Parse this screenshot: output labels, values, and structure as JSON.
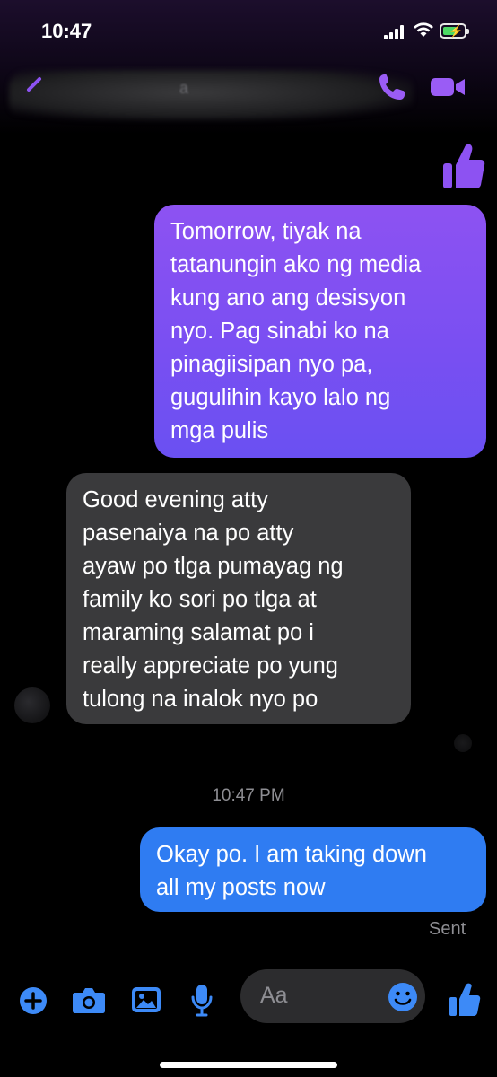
{
  "status_bar": {
    "time": "10:47"
  },
  "header": {
    "contact_name_blurred": "a"
  },
  "messages": [
    {
      "sender": "me",
      "lines": [
        "Tomorrow, tiyak na",
        "tatanungin ako ng media",
        "kung ano ang desisyon",
        "nyo. Pag sinabi ko na",
        "pinagiisipan nyo pa,",
        "gugulihin kayo lalo ng",
        "mga pulis"
      ]
    },
    {
      "sender": "them",
      "lines": [
        "Good evening atty",
        "pasenaiya na po atty",
        "ayaw po tlga pumayag ng",
        "family ko sori po tlga at",
        "maraming salamat po i",
        "really appreciate po yung",
        "tulong na inalok nyo po"
      ]
    },
    {
      "sender": "me",
      "lines": [
        "Okay po. I am taking down",
        "all my posts now"
      ]
    }
  ],
  "timestamp": "10:47 PM",
  "delivery_status": "Sent",
  "composer": {
    "placeholder": "Aa"
  },
  "colors": {
    "accent": "#8d52f2",
    "outgoing_blue": "#2f7cf2",
    "incoming_gray": "#3a3a3c",
    "composer_icon": "#3d8af7"
  }
}
